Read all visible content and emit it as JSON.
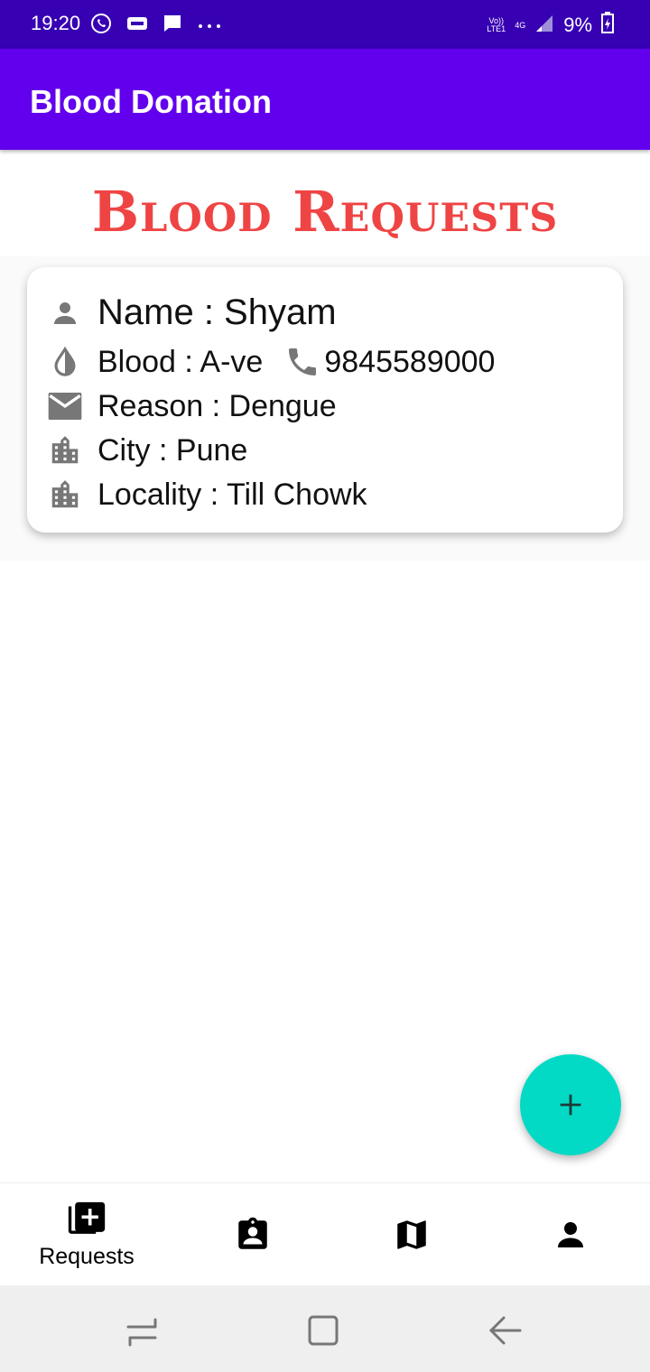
{
  "status_bar": {
    "time": "19:20",
    "battery": "9%",
    "network_top": "Vo))",
    "network_bottom": "LTE1",
    "network_type": "4G",
    "icons": [
      "whatsapp-icon",
      "idea-icon",
      "message-icon",
      "more-dots-icon",
      "signal-icon",
      "battery-icon"
    ]
  },
  "app_bar": {
    "title": "Blood Donation",
    "color": "#6200ee"
  },
  "page": {
    "heading": "Blood Requests",
    "heading_color": "#ef4444"
  },
  "requests": [
    {
      "name_text": "Name : Shyam",
      "blood_text": "Blood : A-ve",
      "phone": "9845589000",
      "reason_text": "Reason : Dengue",
      "city_text": "City : Pune",
      "locality_text": "Locality : Till Chowk"
    }
  ],
  "fab": {
    "icon": "plus-icon",
    "color": "#03dac5"
  },
  "bottom_nav": {
    "items": [
      {
        "label": "Requests",
        "icon": "add-box-icon",
        "selected": true
      },
      {
        "label": "",
        "icon": "badge-icon",
        "selected": false
      },
      {
        "label": "",
        "icon": "map-icon",
        "selected": false
      },
      {
        "label": "",
        "icon": "person-icon",
        "selected": false
      }
    ]
  }
}
